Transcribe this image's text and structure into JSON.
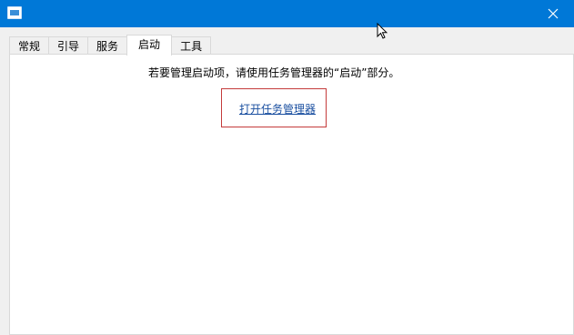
{
  "window": {
    "title_bar_color": "#0078d7",
    "close_icon": "close-icon",
    "app_icon": "system-config-icon"
  },
  "tabs": [
    {
      "label": "常规",
      "active": false
    },
    {
      "label": "引导",
      "active": false
    },
    {
      "label": "服务",
      "active": false
    },
    {
      "label": "启动",
      "active": true
    },
    {
      "label": "工具",
      "active": false
    }
  ],
  "startup": {
    "message": "若要管理启动项，请使用任务管理器的“启动”部分。",
    "link_label": "打开任务管理器",
    "highlight_color": "#c43b3b"
  }
}
